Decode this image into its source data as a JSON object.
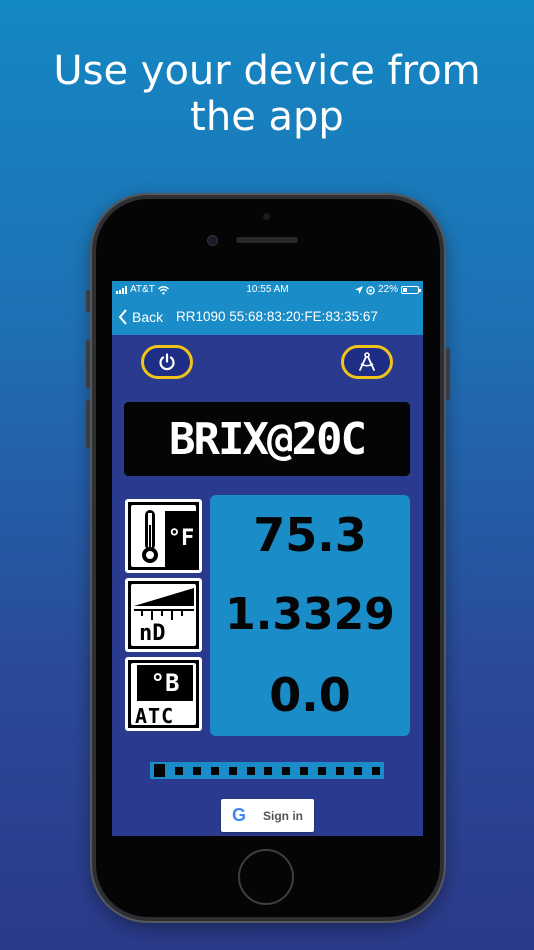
{
  "headline": {
    "line1": "Use your device from",
    "line2": "the app"
  },
  "status_bar": {
    "carrier": "AT&T",
    "time": "10:55 AM",
    "battery": "22%"
  },
  "nav": {
    "back_label": "Back",
    "title": "RR1090 55:68:83:20:FE:83:35:67"
  },
  "display": {
    "mode": "BRIX@20C"
  },
  "readings": {
    "temperature": "75.3",
    "refractive_index": "1.3329",
    "brix": "0.0"
  },
  "icon_labels": {
    "temperature_unit": "°F",
    "nd_label": "nD",
    "brix_unit": "°B",
    "atc_label": "ATC"
  },
  "progress": {
    "segments": 13,
    "filled": 1
  },
  "signin": {
    "label": "Sign in",
    "google_glyph": "G"
  },
  "colors": {
    "accent": "#1a8cc7",
    "background": "#2a3a8f",
    "button_border": "#f0c419"
  }
}
